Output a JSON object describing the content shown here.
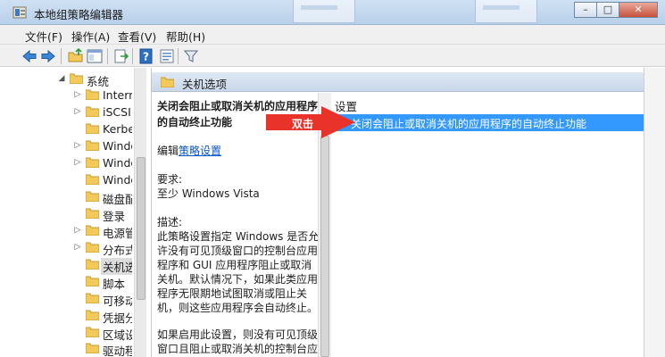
{
  "window": {
    "title": "本地组策略编辑器",
    "controls": [
      "minimize",
      "maximize",
      "close"
    ]
  },
  "menu": [
    {
      "label": "文件(F)"
    },
    {
      "label": "操作(A)"
    },
    {
      "label": "查看(V)"
    },
    {
      "label": "帮助(H)"
    }
  ],
  "toolbar": [
    {
      "icon": "back-arrow-icon"
    },
    {
      "icon": "forward-arrow-icon"
    },
    {
      "icon": "up-folder-icon"
    },
    {
      "icon": "show-hide-tree-icon"
    },
    {
      "icon": "export-list-icon"
    },
    {
      "icon": "help-icon"
    },
    {
      "icon": "properties-icon"
    },
    {
      "icon": "filter-icon"
    }
  ],
  "tree": {
    "items": [
      {
        "label": "系统",
        "expander": "expanded"
      },
      {
        "label": "Internet",
        "expander": "collapsed"
      },
      {
        "label": "iSCSI",
        "expander": "collapsed"
      },
      {
        "label": "Kerberos",
        "expander": "none"
      },
      {
        "label": "Windows",
        "expander": "collapsed"
      },
      {
        "label": "Windows",
        "expander": "collapsed"
      },
      {
        "label": "Windows",
        "expander": "none"
      },
      {
        "label": "磁盘配额",
        "expander": "none"
      },
      {
        "label": "登录",
        "expander": "none"
      },
      {
        "label": "电源管理",
        "expander": "collapsed"
      },
      {
        "label": "分布式",
        "expander": "collapsed"
      },
      {
        "label": "关机选项",
        "expander": "none",
        "selected": true
      },
      {
        "label": "脚本",
        "expander": "none"
      },
      {
        "label": "可移动",
        "expander": "none"
      },
      {
        "label": "凭据分配",
        "expander": "none"
      },
      {
        "label": "区域设置",
        "expander": "none"
      },
      {
        "label": "驱动程序",
        "expander": "none"
      }
    ]
  },
  "content": {
    "header": "关机选项",
    "description": {
      "title": "关闭会阻止或取消关机的应用程序的自动终止功能",
      "edit_prefix": "编辑",
      "edit_link": "策略设置",
      "requirements_label": "要求:",
      "requirements": "至少 Windows Vista",
      "desc_label": "描述:",
      "desc_lines": [
        "此策略设置指定 Windows 是否允",
        "许没有可见顶级窗口的控制台应用",
        "程序和 GUI 应用程序阻止或取消",
        "关机。默认情况下，如果此类应用",
        "程序无限期地试图取消或阻止关",
        "机，则这些应用程序会自动终止。"
      ],
      "more_lines": [
        "如果启用此设置，则没有可见顶级",
        "窗口且阻止或取消关机的控制台应"
      ]
    },
    "settings": {
      "column_header": "设置",
      "items": [
        {
          "label": "关闭会阻止或取消关机的应用程序的自动终止功能",
          "selected": true
        }
      ]
    }
  },
  "annotation": {
    "label": "双击",
    "color": "#e8322a"
  },
  "colors": {
    "selection": "#3399ff",
    "link": "#0a57c8",
    "folder": "#f3c95a"
  }
}
